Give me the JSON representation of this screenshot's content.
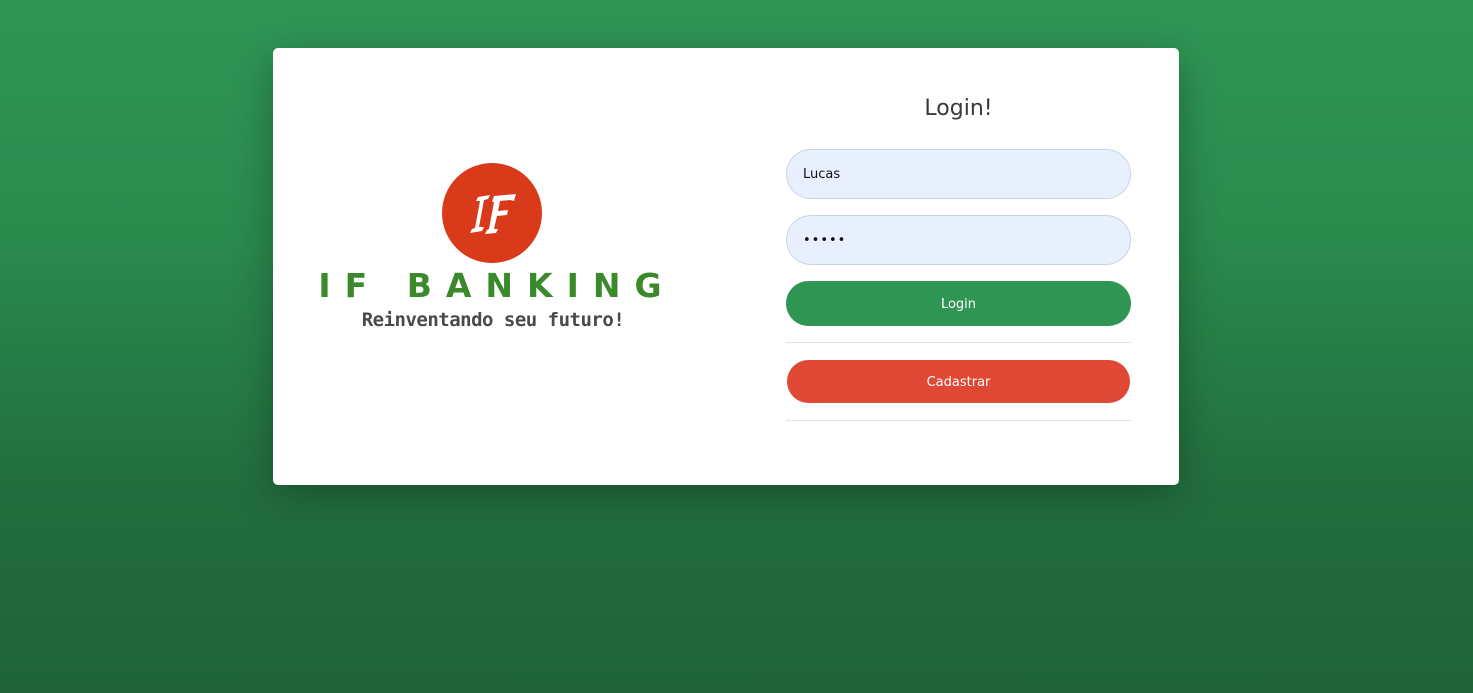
{
  "brand": {
    "logo_letters": "IF",
    "name": "IF BANKING",
    "tagline": "Reinventando seu futuro!"
  },
  "login_form": {
    "title": "Login!",
    "username_value": "Lucas",
    "password_value": "•••••",
    "login_button_label": "Login",
    "register_button_label": "Cadastrar"
  },
  "colors": {
    "background": "#2a8a4c",
    "logo_circle": "#d93a1a",
    "brand_text": "#3a8a2c",
    "login_button": "#2f9553",
    "register_button": "#e04836",
    "input_fill": "#e8f0fe"
  }
}
